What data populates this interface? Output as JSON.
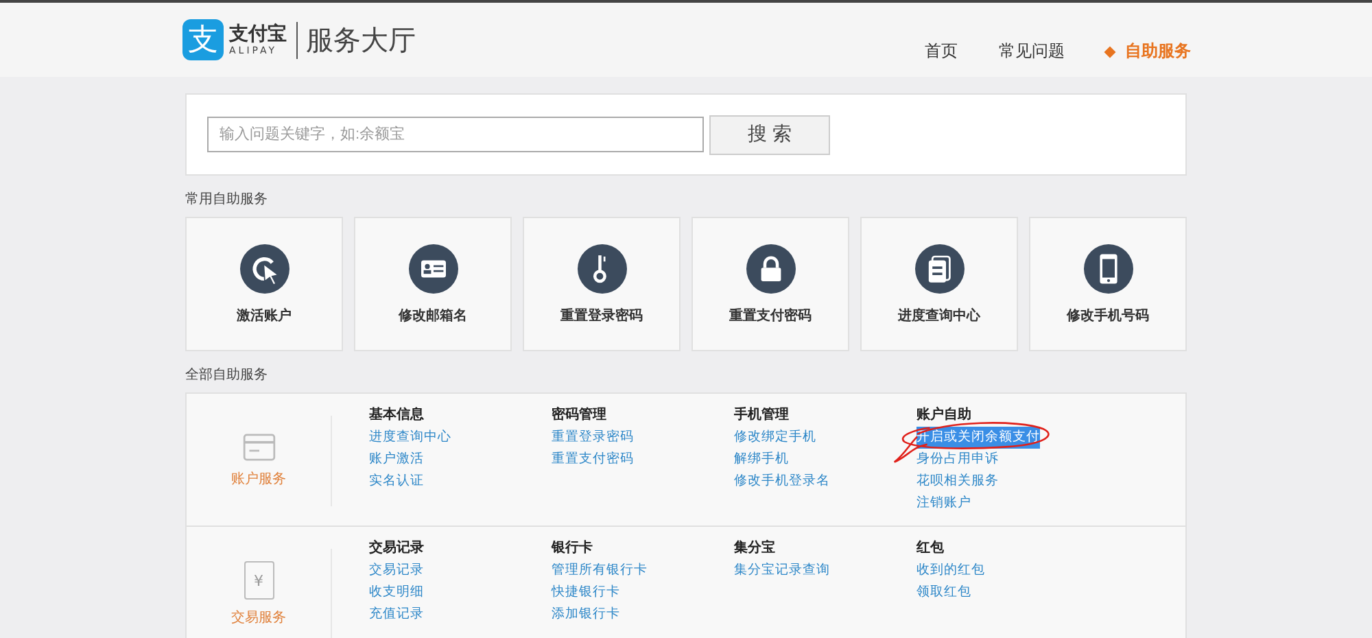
{
  "header": {
    "logo_mark": "支",
    "logo_name": "支付宝",
    "logo_sub": "ALIPAY",
    "hall_title": "服务大厅",
    "nav": [
      {
        "label": "首页",
        "selected": false
      },
      {
        "label": "常见问题",
        "selected": false
      },
      {
        "label": "自助服务",
        "selected": true
      }
    ]
  },
  "search": {
    "placeholder": "输入问题关键字，如:余额宝",
    "button": "搜 索"
  },
  "common_title": "常用自助服务",
  "common_services": [
    {
      "label": "激活账户"
    },
    {
      "label": "修改邮箱名"
    },
    {
      "label": "重置登录密码"
    },
    {
      "label": "重置支付密码"
    },
    {
      "label": "进度查询中心"
    },
    {
      "label": "修改手机号码"
    }
  ],
  "all_title": "全部自助服务",
  "sections": [
    {
      "label": "账户服务",
      "groups": [
        {
          "title": "基本信息",
          "links": [
            {
              "text": "进度查询中心",
              "highlighted": false,
              "annotated": false
            },
            {
              "text": "账户激活",
              "highlighted": false,
              "annotated": false
            },
            {
              "text": "实名认证",
              "highlighted": false,
              "annotated": false
            }
          ]
        },
        {
          "title": "密码管理",
          "links": [
            {
              "text": "重置登录密码",
              "highlighted": false,
              "annotated": false
            },
            {
              "text": "重置支付密码",
              "highlighted": false,
              "annotated": false
            }
          ]
        },
        {
          "title": "手机管理",
          "links": [
            {
              "text": "修改绑定手机",
              "highlighted": false,
              "annotated": false
            },
            {
              "text": "解绑手机",
              "highlighted": false,
              "annotated": false
            },
            {
              "text": "修改手机登录名",
              "highlighted": false,
              "annotated": false
            }
          ]
        },
        {
          "title": "账户自助",
          "links": [
            {
              "text": "开启或关闭余额支付",
              "highlighted": true,
              "annotated": true
            },
            {
              "text": "身份占用申诉",
              "highlighted": false,
              "annotated": false
            },
            {
              "text": "花呗相关服务",
              "highlighted": false,
              "annotated": false
            },
            {
              "text": "注销账户",
              "highlighted": false,
              "annotated": false
            }
          ]
        }
      ]
    },
    {
      "label": "交易服务",
      "glyph": "¥",
      "groups": [
        {
          "title": "交易记录",
          "links": [
            {
              "text": "交易记录",
              "highlighted": false,
              "annotated": false
            },
            {
              "text": "收支明细",
              "highlighted": false,
              "annotated": false
            },
            {
              "text": "充值记录",
              "highlighted": false,
              "annotated": false
            }
          ]
        },
        {
          "title": "银行卡",
          "links": [
            {
              "text": "管理所有银行卡",
              "highlighted": false,
              "annotated": false
            },
            {
              "text": "快捷银行卡",
              "highlighted": false,
              "annotated": false
            },
            {
              "text": "添加银行卡",
              "highlighted": false,
              "annotated": false
            }
          ]
        },
        {
          "title": "集分宝",
          "links": [
            {
              "text": "集分宝记录查询",
              "highlighted": false,
              "annotated": false
            }
          ]
        },
        {
          "title": "红包",
          "links": [
            {
              "text": "收到的红包",
              "highlighted": false,
              "annotated": false
            },
            {
              "text": "领取红包",
              "highlighted": false,
              "annotated": false
            }
          ]
        }
      ]
    }
  ]
}
